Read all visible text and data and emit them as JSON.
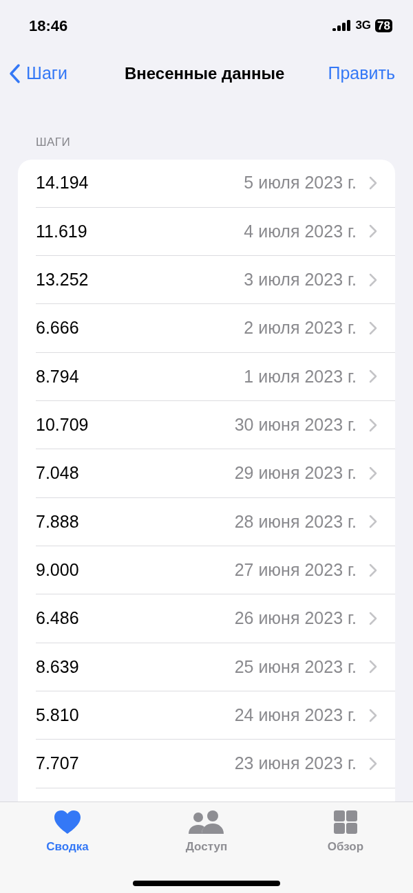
{
  "status_bar": {
    "time": "18:46",
    "network": "3G",
    "battery": "78"
  },
  "nav": {
    "back": "Шаги",
    "title": "Внесенные данные",
    "action": "Править"
  },
  "section": {
    "header": "ШАГИ",
    "rows": [
      {
        "value": "14.194",
        "date": "5 июля 2023 г."
      },
      {
        "value": "11.619",
        "date": "4 июля 2023 г."
      },
      {
        "value": "13.252",
        "date": "3 июля 2023 г."
      },
      {
        "value": "6.666",
        "date": "2 июля 2023 г."
      },
      {
        "value": "8.794",
        "date": "1 июля 2023 г."
      },
      {
        "value": "10.709",
        "date": "30 июня 2023 г."
      },
      {
        "value": "7.048",
        "date": "29 июня 2023 г."
      },
      {
        "value": "7.888",
        "date": "28 июня 2023 г."
      },
      {
        "value": "9.000",
        "date": "27 июня 2023 г."
      },
      {
        "value": "6.486",
        "date": "26 июня 2023 г."
      },
      {
        "value": "8.639",
        "date": "25 июня 2023 г."
      },
      {
        "value": "5.810",
        "date": "24 июня 2023 г."
      },
      {
        "value": "7.707",
        "date": "23 июня 2023 г."
      }
    ]
  },
  "tab_bar": [
    {
      "kind": "heart",
      "label": "Сводка",
      "selected": true
    },
    {
      "kind": "people",
      "label": "Доступ",
      "selected": false
    },
    {
      "kind": "grid",
      "label": "Обзор",
      "selected": false
    }
  ]
}
